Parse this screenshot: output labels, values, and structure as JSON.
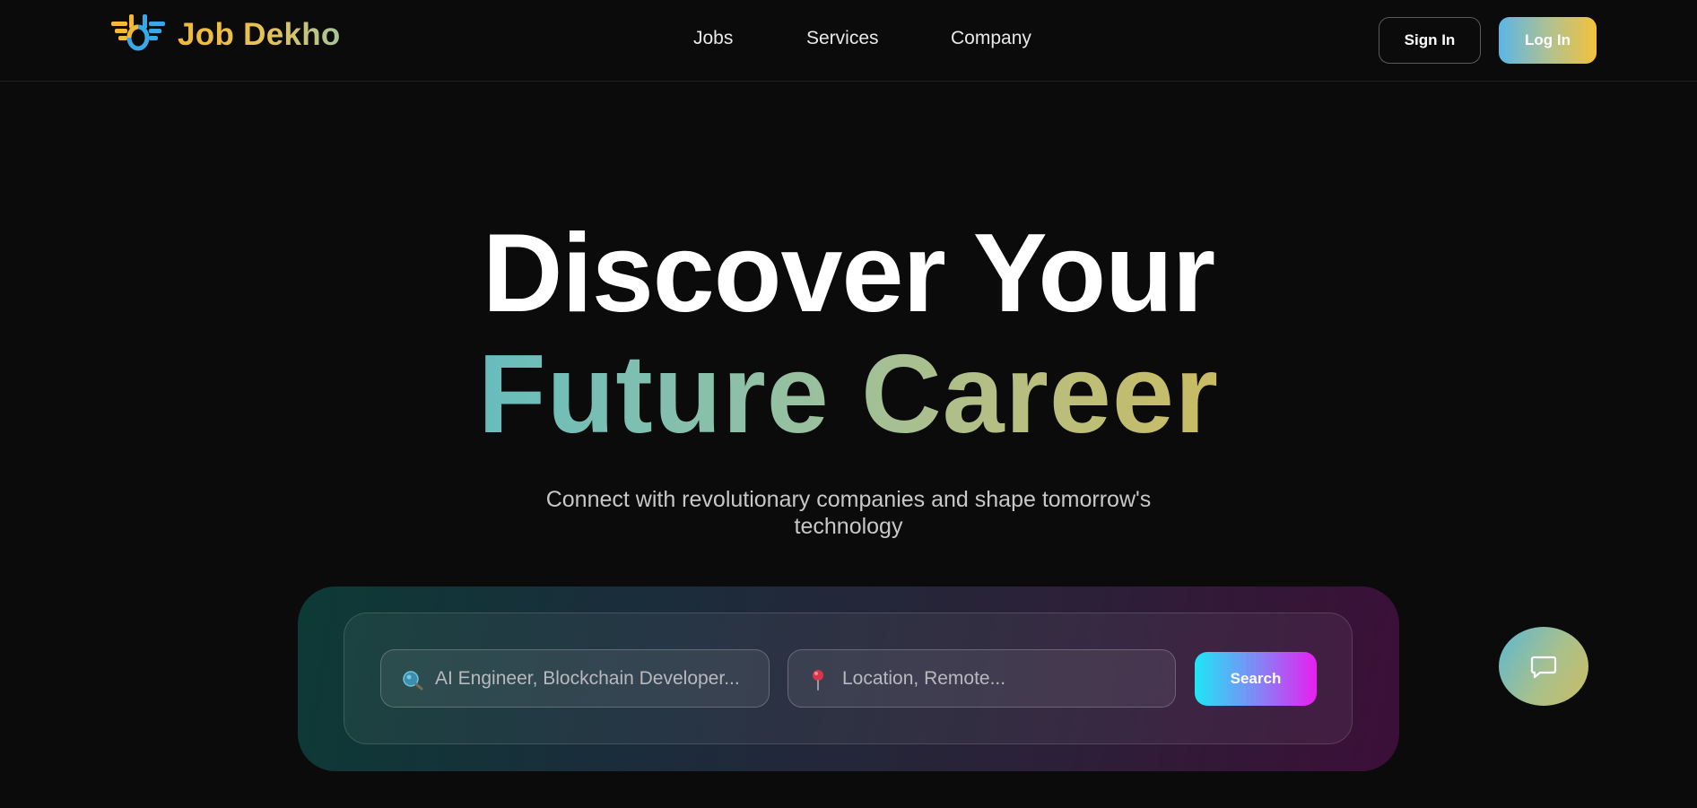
{
  "brand": {
    "name": "Job Dekho",
    "logo_icon": "winged-emblem-icon"
  },
  "nav": {
    "items": [
      "Jobs",
      "Services",
      "Company"
    ]
  },
  "auth": {
    "sign_in_label": "Sign In",
    "log_in_label": "Log In"
  },
  "hero": {
    "line1": "Discover Your",
    "line2": "Future Career",
    "subtitle_line1": "Connect with revolutionary companies and shape tomorrow's",
    "subtitle_line2": "technology"
  },
  "search": {
    "job_placeholder": "AI Engineer, Blockchain Developer...",
    "job_value": "",
    "job_icon": "magnifier-icon",
    "location_placeholder": "Location, Remote...",
    "location_value": "",
    "location_icon": "pushpin-icon",
    "button_label": "Search"
  },
  "chat": {
    "icon": "chat-bubble-icon"
  },
  "colors": {
    "background": "#0b0b0b",
    "brand_gold": "#f4b935",
    "login_gradient": [
      "#5ab6e6",
      "#f2c23a"
    ],
    "search_gradient": [
      "#1fe6f5",
      "#e81ef0"
    ],
    "hero_gradient": [
      "#66bdbd",
      "#c9bc62"
    ]
  }
}
